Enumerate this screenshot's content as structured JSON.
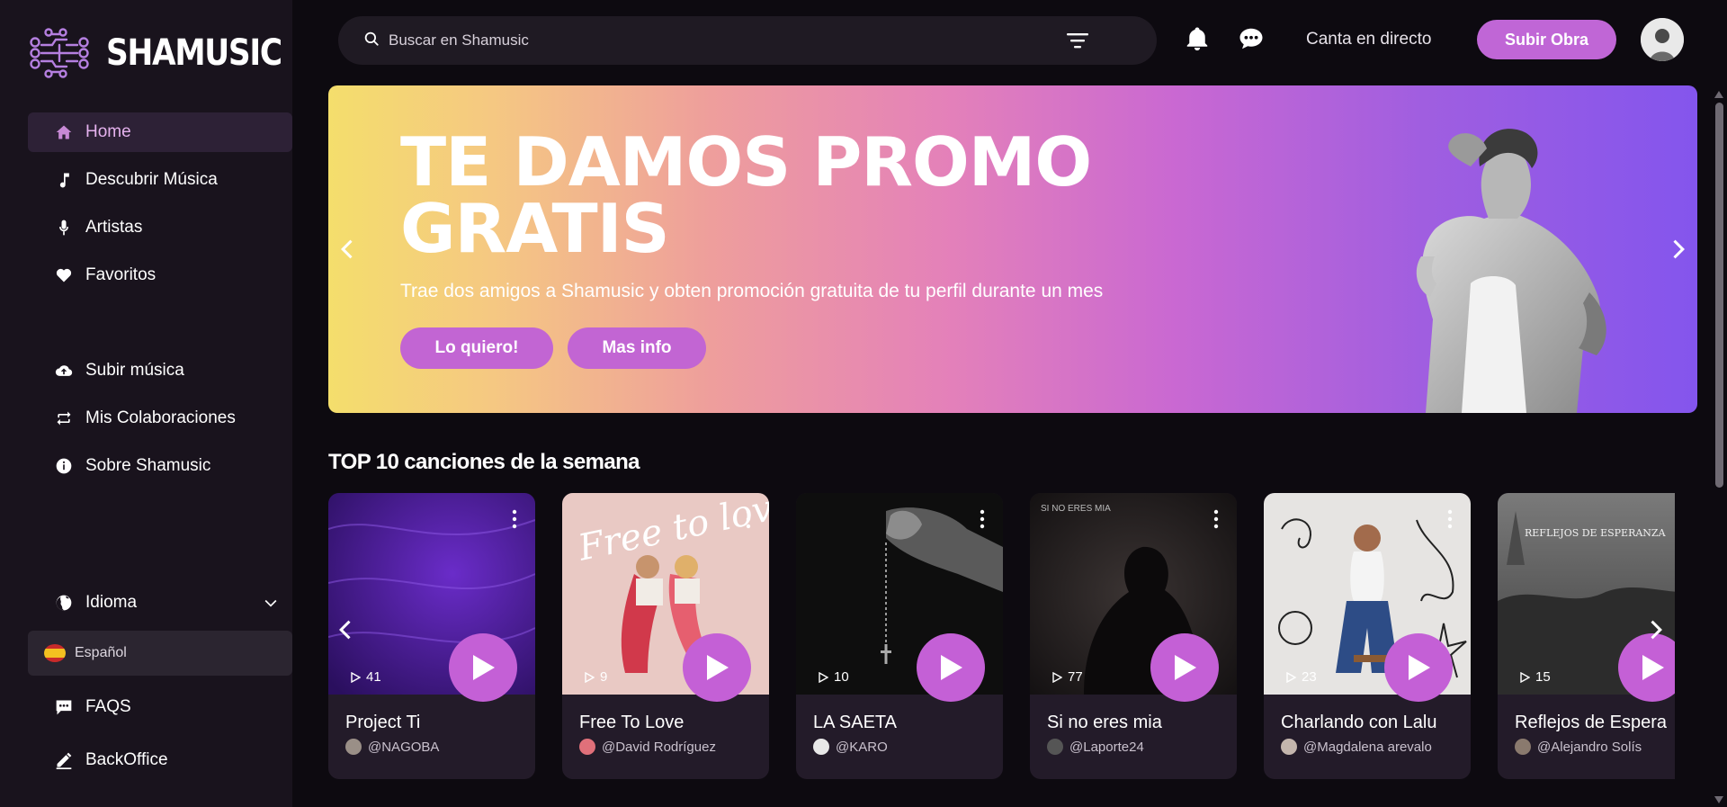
{
  "app": {
    "name": "SHAMUSIC"
  },
  "sidebar": {
    "items": [
      {
        "label": "Home",
        "icon": "home-icon"
      },
      {
        "label": "Descubrir Música",
        "icon": "music-note-icon"
      },
      {
        "label": "Artistas",
        "icon": "microphone-icon"
      },
      {
        "label": "Favoritos",
        "icon": "heart-icon"
      },
      {
        "label": "Subir música",
        "icon": "cloud-upload-icon"
      },
      {
        "label": "Mis Colaboraciones",
        "icon": "repeat-icon"
      },
      {
        "label": "Sobre Shamusic",
        "icon": "info-icon"
      }
    ],
    "language_label": "Idioma",
    "language_value": "Español",
    "faqs": "FAQS",
    "backoffice": "BackOffice"
  },
  "topbar": {
    "search_placeholder": "Buscar en Shamusic",
    "live_link": "Canta en directo",
    "upload_button": "Subir Obra"
  },
  "banner": {
    "title": "TE DAMOS PROMO GRATIS",
    "subtitle": "Trae dos amigos a Shamusic y obten promoción gratuita de tu perfil durante un mes",
    "primary_button": "Lo quiero!",
    "secondary_button": "Mas info"
  },
  "top10": {
    "title": "TOP 10 canciones de la semana",
    "songs": [
      {
        "title": "Project Ti",
        "artist": "@NAGOBA",
        "plays": "41"
      },
      {
        "title": "Free To Love",
        "artist": "@David Rodríguez",
        "plays": "9"
      },
      {
        "title": "LA SAETA",
        "artist": "@KARO",
        "plays": "10"
      },
      {
        "title": "Si no eres mia",
        "artist": "@Laporte24",
        "plays": "77"
      },
      {
        "title": "Charlando con Lalu",
        "artist": "@Magdalena arevalo",
        "plays": "23"
      },
      {
        "title": "Reflejos de Espera",
        "artist": "@Alejandro Solís",
        "plays": "15"
      }
    ]
  },
  "covers": {
    "free_to_love_text": "Free to love",
    "si_no_eres_mia_text": "SI NO ERES MIA",
    "reflejos_text": "REFLEJOS DE ESPERANZA"
  },
  "colors": {
    "accent": "#c066d6",
    "sidebar_bg": "#19131d",
    "page_bg": "#0d0a10",
    "card_bg": "#231b29"
  }
}
